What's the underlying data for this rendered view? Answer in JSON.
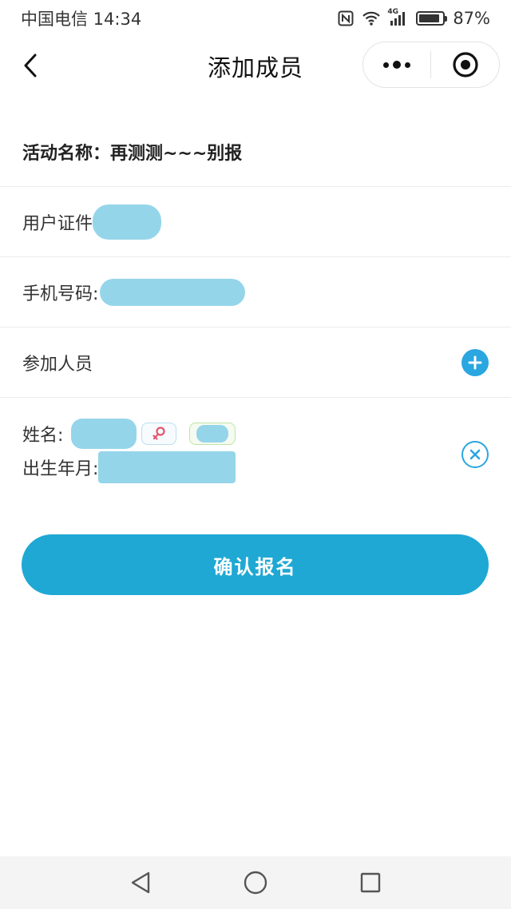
{
  "status_bar": {
    "carrier_time": "中国电信 14:34",
    "network": "4G",
    "battery": "87%",
    "battery_level": 0.87
  },
  "nav": {
    "title": "添加成员"
  },
  "form": {
    "activity": "活动名称：再测测~~~别报",
    "id_label": "用户证件",
    "phone_label": "手机号码:",
    "participants_label": "参加人员"
  },
  "member": {
    "name_label": "姓名:",
    "birth_label": "出生年月:"
  },
  "confirm_label": "确认报名",
  "colors": {
    "accent": "#1fa8d4",
    "redaction": "#8fd3e9"
  },
  "icons": [
    "back-icon",
    "more-icon",
    "target-icon",
    "nfc-icon",
    "wifi-icon",
    "signal-icon",
    "battery-icon",
    "add-icon",
    "female-icon",
    "remove-icon",
    "back-triangle-icon",
    "home-circle-icon",
    "recents-square-icon"
  ]
}
